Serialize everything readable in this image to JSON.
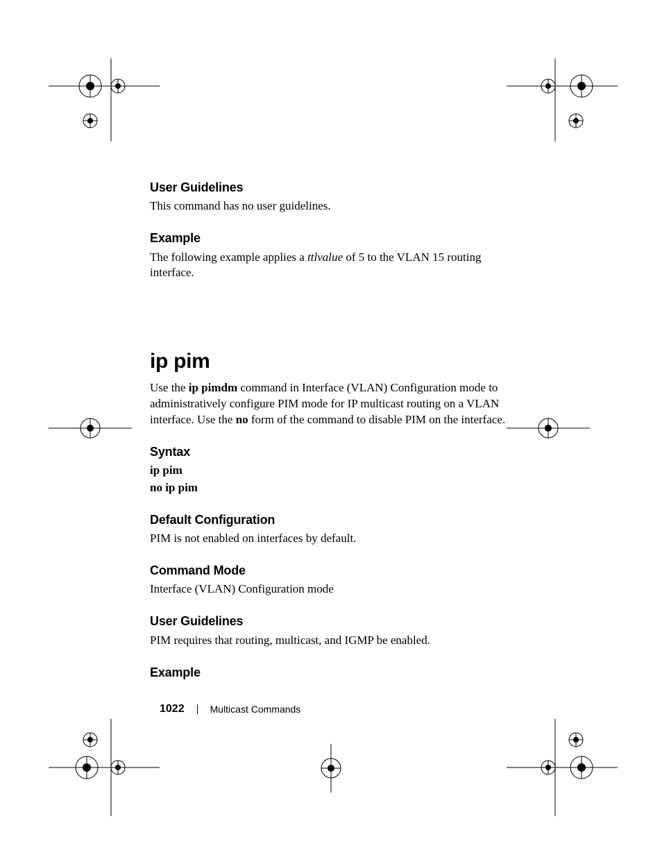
{
  "sec1": {
    "heading": "User Guidelines",
    "body": "This command has no user guidelines."
  },
  "sec2": {
    "heading": "Example",
    "body_pre": "The following example applies a ",
    "body_ital": "ttlvalue",
    "body_post": " of 5 to the VLAN 15 routing interface."
  },
  "cmd": {
    "title": "ip pim",
    "intro_pre": "Use the ",
    "intro_bold1": "ip pimdm",
    "intro_mid": " command in Interface (VLAN) Configuration mode to administratively configure PIM mode for IP multicast routing on a VLAN interface. Use the ",
    "intro_bold2": "no",
    "intro_post": " form of the command to disable PIM on the interface."
  },
  "syntax": {
    "heading": "Syntax",
    "line1": "ip pim",
    "line2": "no ip pim"
  },
  "defcfg": {
    "heading": "Default Configuration",
    "body": "PIM is not enabled on interfaces by default."
  },
  "cmdmode": {
    "heading": "Command Mode",
    "body": "Interface (VLAN) Configuration mode"
  },
  "ug2": {
    "heading": "User Guidelines",
    "body": "PIM requires that routing, multicast, and IGMP be enabled."
  },
  "ex2": {
    "heading": "Example"
  },
  "footer": {
    "page": "1022",
    "chapter": "Multicast Commands"
  }
}
